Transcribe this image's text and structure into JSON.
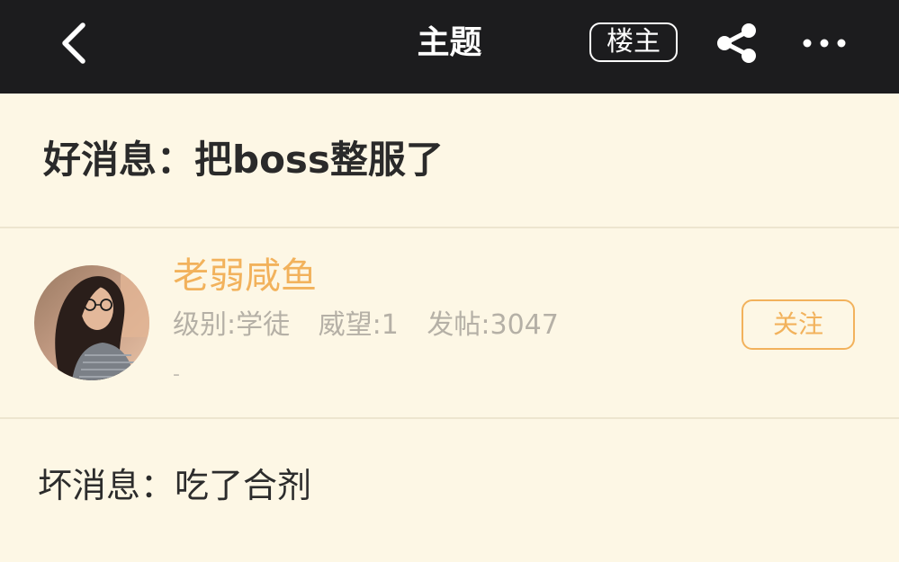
{
  "nav": {
    "title": "主题",
    "op_badge": "楼主",
    "icons": {
      "back": "chevron-left-icon",
      "share": "share-icon",
      "more": "more-horizontal-icon"
    }
  },
  "post": {
    "title": "好消息：把boss整服了",
    "body": "坏消息：吃了合剂"
  },
  "author": {
    "name": "老弱咸鱼",
    "level": "级别:学徒",
    "prestige": "威望:1",
    "posts": "发帖:3047",
    "signature": "-",
    "follow_label": "关注"
  },
  "colors": {
    "navbar_bg": "#1c1c1e",
    "page_bg": "#fdf7e5",
    "accent": "#f2b25c",
    "muted_text": "#b5b0a6",
    "divider": "#ede5cf"
  }
}
